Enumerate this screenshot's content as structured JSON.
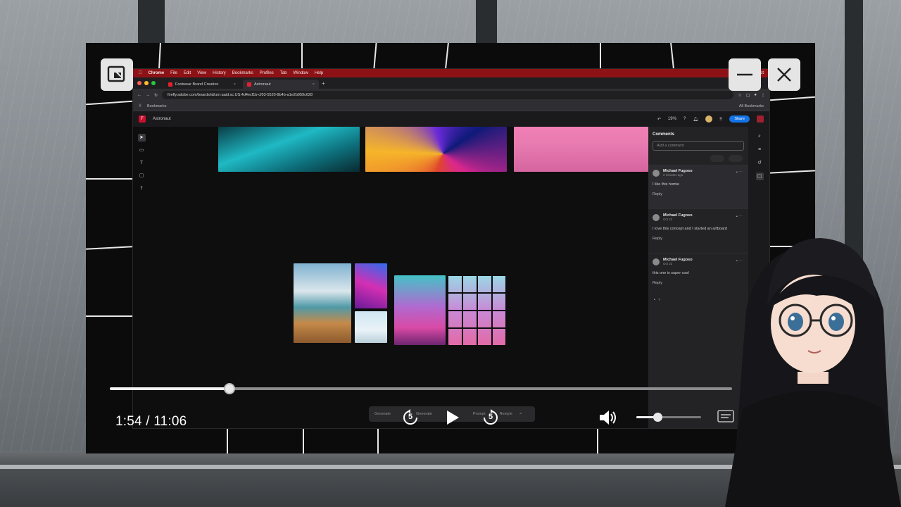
{
  "player": {
    "time_display": "1:54 / 11:06",
    "progress_fraction": 0.192,
    "volume_fraction": 0.33,
    "skip_back_seconds": "5",
    "skip_forward_seconds": "5"
  },
  "browser": {
    "menubar": [
      "Chrome",
      "File",
      "Edit",
      "View",
      "History",
      "Bookmarks",
      "Profiles",
      "Tab",
      "Window",
      "Help"
    ],
    "menubar_right": "Tue Oct",
    "tabs": [
      {
        "label": "Footwear Brand Creation"
      },
      {
        "label": "Astronaut"
      }
    ],
    "url": "firefly.adobe.com/boards/id/urn:aaid:sc:US:4d4ecf1b-cf03-5520-8b4b-a1e2b959c628",
    "bookmarks_label": "Bookmarks",
    "all_bookmarks_label": "All Bookmarks"
  },
  "app": {
    "title": "Astronaut",
    "zoom": "19%",
    "share_label": "Share"
  },
  "comments": {
    "heading": "Comments",
    "input_placeholder": "Add a comment",
    "items": [
      {
        "name": "Michael Fugoso",
        "time": "2 minutes ago",
        "text": "I like this homie",
        "reply": "Reply"
      },
      {
        "name": "Michael Fugoso",
        "time": "Oct 22",
        "text": "I love this concept and I started an artboard",
        "reply": "Reply"
      },
      {
        "name": "Michael Fugoso",
        "time": "Oct 22",
        "text": "this one is super cool",
        "reply": "Reply"
      }
    ]
  },
  "control_strip": {
    "items": [
      "Generate",
      "Generate",
      "Prompt",
      "Restyle"
    ]
  },
  "icons": {
    "pip": "picture-in-picture-icon",
    "minimize": "minimize-icon",
    "close": "close-icon",
    "play": "play-icon",
    "volume": "volume-icon",
    "captions": "captions-icon"
  },
  "colors": {
    "accent_red": "#8d1216",
    "share_blue": "#1473e6"
  }
}
